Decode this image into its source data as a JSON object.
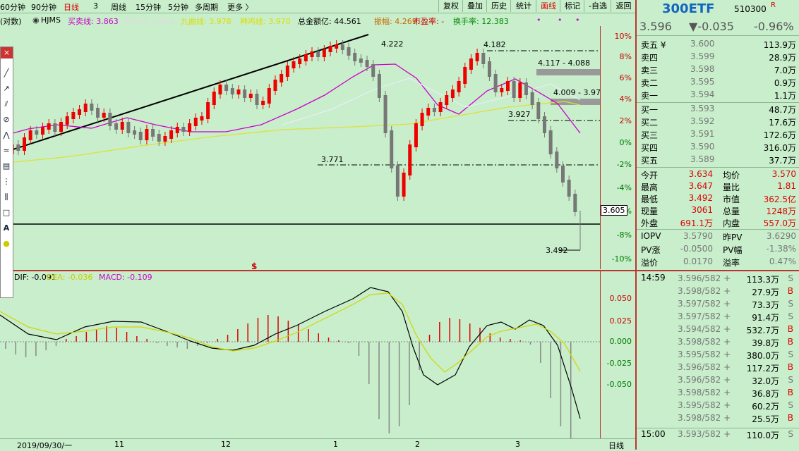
{
  "toolbar": {
    "periods": [
      "60分钟",
      "90分钟",
      "日线",
      "3",
      "周线",
      "15分钟",
      "5分钟",
      "多周期",
      "更多 〉"
    ],
    "buttons": [
      "复权",
      "叠加",
      "历史",
      "统计",
      "画线",
      "标记",
      "-自选",
      "返回"
    ]
  },
  "legend": {
    "prefix": "(对数)",
    "hjms": "HJMS",
    "buy": "买卖线: 3.863",
    "life": "生命线: 3.993",
    "mid": "九曲线: 3.978",
    "lt": "神鸡线: 3.970",
    "amount": "总金额亿: 44.561",
    "amp": "振幅: 4.269",
    "pe": "市盈率: -",
    "turnover": "换手率: 12.383"
  },
  "price_axis": [
    "10%",
    "8%",
    "6%",
    "4%",
    "2%",
    "0%",
    "-2%",
    "-4%",
    "-6%",
    "-8%",
    "-10%"
  ],
  "price_box": "3.605",
  "annotations": {
    "a1": "4.222",
    "a2": "4.182",
    "a3": "4.117 - 4.088",
    "a4": "4.009 - 3.97",
    "a5": "3.927",
    "a6": "3.771",
    "a7": "3.492",
    "sym": "$"
  },
  "macd": {
    "dif": "DIF: -0.091",
    "dea": "DEA: -0.036",
    "macd": "MACD: -0.109",
    "axis": [
      "0.050",
      "0.025",
      "0.000",
      "-0.025",
      "-0.050"
    ]
  },
  "dates": [
    "2019/09/30/一",
    "11",
    "12",
    "1",
    "2",
    "3",
    "日线"
  ],
  "toolbox": [
    "×",
    "A"
  ],
  "panel": {
    "code": "300ETF",
    "num": "510300",
    "r": "R",
    "last": "3.596",
    "change": "▼-0.035",
    "pct": "-0.96%",
    "sells": [
      {
        "label": "卖五 ¥",
        "price": "3.600",
        "vol": "113.9万"
      },
      {
        "label": "卖四",
        "price": "3.599",
        "vol": "28.9万"
      },
      {
        "label": "卖三",
        "price": "3.598",
        "vol": "7.0万"
      },
      {
        "label": "卖二",
        "price": "3.595",
        "vol": "0.9万"
      },
      {
        "label": "卖一",
        "price": "3.594",
        "vol": "1.1万"
      }
    ],
    "buys": [
      {
        "label": "买一",
        "price": "3.593",
        "vol": "48.7万"
      },
      {
        "label": "买二",
        "price": "3.592",
        "vol": "17.6万"
      },
      {
        "label": "买三",
        "price": "3.591",
        "vol": "172.6万"
      },
      {
        "label": "买四",
        "price": "3.590",
        "vol": "316.0万"
      },
      {
        "label": "买五",
        "price": "3.589",
        "vol": "37.7万"
      }
    ],
    "stats": [
      {
        "l1": "今开",
        "v1": "3.634",
        "l2": "均价",
        "v2": "3.570"
      },
      {
        "l1": "最高",
        "v1": "3.647",
        "l2": "量比",
        "v2": "1.81"
      },
      {
        "l1": "最低",
        "v1": "3.492",
        "l2": "市值",
        "v2": "362.5亿"
      },
      {
        "l1": "现量",
        "v1": "3061",
        "l2": "总量",
        "v2": "1248万"
      },
      {
        "l1": "外盘",
        "v1": "691.1万",
        "l2": "内盘",
        "v2": "557.0万"
      }
    ],
    "iopv": [
      {
        "l1": "IOPV",
        "v1": "3.5790",
        "l2": "昨PV",
        "v2": "3.6290"
      },
      {
        "l1": "PV涨",
        "v1": "-0.0500",
        "l2": "PV幅",
        "v2": "-1.38%"
      },
      {
        "l1": "溢价",
        "v1": "0.0170",
        "l2": "溢率",
        "v2": "0.47%"
      }
    ],
    "ticks_time": "14:59",
    "ticks": [
      {
        "p": "3.596/582 +",
        "v": "113.3万",
        "s": "S"
      },
      {
        "p": "3.598/582 +",
        "v": "27.9万",
        "s": "B"
      },
      {
        "p": "3.597/582 +",
        "v": "73.3万",
        "s": "S"
      },
      {
        "p": "3.597/582 +",
        "v": "91.4万",
        "s": "S"
      },
      {
        "p": "3.594/582 +",
        "v": "532.7万",
        "s": "B"
      },
      {
        "p": "3.598/582 +",
        "v": "39.8万",
        "s": "B"
      },
      {
        "p": "3.595/582 +",
        "v": "380.0万",
        "s": "S"
      },
      {
        "p": "3.596/582 +",
        "v": "117.2万",
        "s": "B"
      },
      {
        "p": "3.596/582 +",
        "v": "32.0万",
        "s": "S"
      },
      {
        "p": "3.598/582 +",
        "v": "36.8万",
        "s": "B"
      },
      {
        "p": "3.595/582 +",
        "v": "60.2万",
        "s": "S"
      },
      {
        "p": "3.598/582 +",
        "v": "25.5万",
        "s": "B"
      }
    ],
    "last_tick": {
      "t": "15:00",
      "p": "3.593/582 +",
      "v": "110.0万",
      "s": "S"
    }
  }
}
